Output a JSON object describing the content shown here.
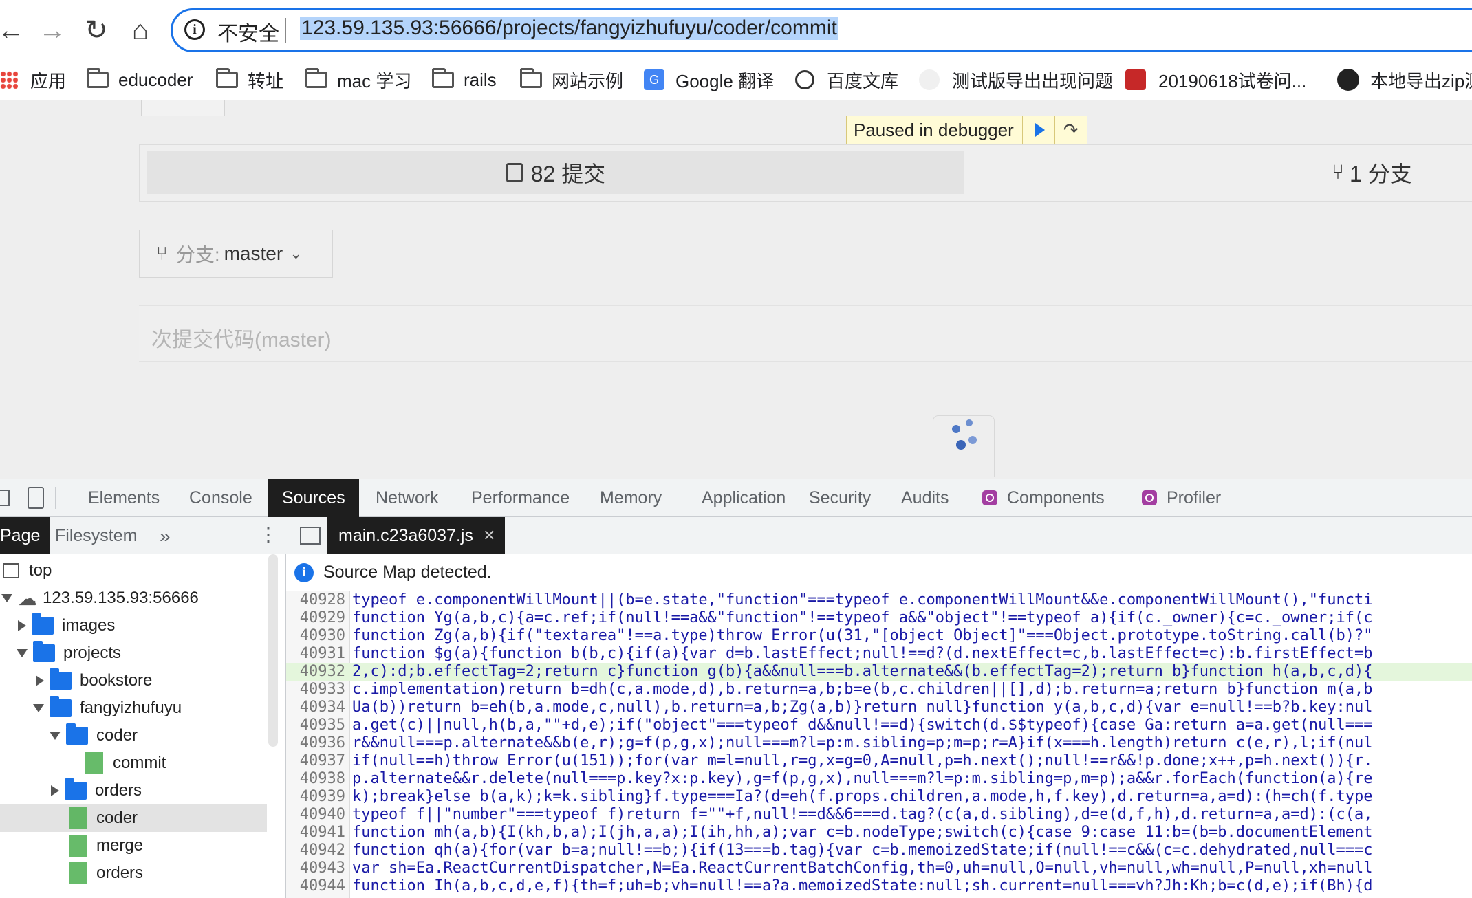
{
  "browser": {
    "security_label": "不安全",
    "url": "123.59.135.93:56666/projects/fangyizhufuyu/coder/commit",
    "bookmarks": [
      "应用",
      "educoder",
      "转址",
      "mac 学习",
      "rails",
      "网站示例",
      "Google 翻译",
      "百度文库",
      "测试版导出出现问题",
      "20190618试卷问...",
      "本地导出zip测"
    ]
  },
  "page": {
    "debugger_banner": "Paused in debugger",
    "commits_label": "82 提交",
    "branches_label": "1 分支",
    "branch_prefix": "分支:",
    "branch_value": "master",
    "commit_placeholder": "次提交代码(master)"
  },
  "devtools": {
    "tabs": [
      "Elements",
      "Console",
      "Sources",
      "Network",
      "Performance",
      "Memory",
      "Application",
      "Security",
      "Audits",
      "Components",
      "Profiler"
    ],
    "active_tab": "Sources",
    "navigator_tabs": [
      "Page",
      "Filesystem"
    ],
    "tree": [
      {
        "label": "top",
        "type": "frame"
      },
      {
        "label": "123.59.135.93:56666",
        "type": "origin"
      },
      {
        "label": "images",
        "type": "folder"
      },
      {
        "label": "projects",
        "type": "folder"
      },
      {
        "label": "bookstore",
        "type": "folder"
      },
      {
        "label": "fangyizhufuyu",
        "type": "folder"
      },
      {
        "label": "coder",
        "type": "folder"
      },
      {
        "label": "commit",
        "type": "file"
      },
      {
        "label": "orders",
        "type": "folder"
      },
      {
        "label": "coder",
        "type": "file"
      },
      {
        "label": "merge",
        "type": "file"
      },
      {
        "label": "orders",
        "type": "file"
      }
    ],
    "open_file": "main.c23a6037.js",
    "info_message": "Source Map detected.",
    "code_lines": [
      {
        "n": "40928",
        "text": "typeof e.componentWillMount||(b=e.state,\"function\"===typeof e.componentWillMount&&e.componentWillMount(),\"functi"
      },
      {
        "n": "40929",
        "text": "function Yg(a,b,c){a=c.ref;if(null!==a&&\"function\"!==typeof a&&\"object\"!==typeof a){if(c._owner){c=c._owner;if(c"
      },
      {
        "n": "40930",
        "text": "function Zg(a,b){if(\"textarea\"!==a.type)throw Error(u(31,\"[object Object]\"===Object.prototype.toString.call(b)?\""
      },
      {
        "n": "40931",
        "text": "function $g(a){function b(b,c){if(a){var d=b.lastEffect;null!==d?(d.nextEffect=c,b.lastEffect=c):b.firstEffect=b"
      },
      {
        "n": "40932",
        "text": "2,c):d;b.effectTag=2;return c}function g(b){a&&null===b.alternate&&(b.effectTag=2);return b}function h(a,b,c,d){"
      },
      {
        "n": "40933",
        "text": "c.implementation)return b=dh(c,a.mode,d),b.return=a,b;b=e(b,c.children||[],d);b.return=a;return b}function m(a,b"
      },
      {
        "n": "40934",
        "text": "Ua(b))return b=eh(b,a.mode,c,null),b.return=a,b;Zg(a,b)}return null}function y(a,b,c,d){var e=null!==b?b.key:nul"
      },
      {
        "n": "40935",
        "text": "a.get(c)||null,h(b,a,\"\"+d,e);if(\"object\"===typeof d&&null!==d){switch(d.$$typeof){case Ga:return a=a.get(null==="
      },
      {
        "n": "40936",
        "text": "r&&null===p.alternate&&b(e,r);g=f(p,g,x);null===m?l=p:m.sibling=p;m=p;r=A}if(x===h.length)return c(e,r),l;if(nul"
      },
      {
        "n": "40937",
        "text": "if(null==h)throw Error(u(151));for(var m=l=null,r=g,x=g=0,A=null,p=h.next();null!==r&&!p.done;x++,p=h.next()){r."
      },
      {
        "n": "40938",
        "text": "p.alternate&&r.delete(null===p.key?x:p.key),g=f(p,g,x),null===m?l=p:m.sibling=p,m=p);a&&r.forEach(function(a){re"
      },
      {
        "n": "40939",
        "text": "k);break}else b(a,k);k=k.sibling}f.type===Ia?(d=eh(f.props.children,a.mode,h,f.key),d.return=a,a=d):(h=ch(f.type"
      },
      {
        "n": "40940",
        "text": "typeof f||\"number\"===typeof f)return f=\"\"+f,null!==d&&6===d.tag?(c(a,d.sibling),d=e(d,f,h),d.return=a,a=d):(c(a,"
      },
      {
        "n": "40941",
        "text": "function mh(a,b){I(kh,b,a);I(jh,a,a);I(ih,hh,a);var c=b.nodeType;switch(c){case 9:case 11:b=(b=b.documentElement"
      },
      {
        "n": "40942",
        "text": "function qh(a){for(var b=a;null!==b;){if(13===b.tag){var c=b.memoizedState;if(null!==c&&(c=c.dehydrated,null===c"
      },
      {
        "n": "40943",
        "text": "var sh=Ea.ReactCurrentDispatcher,N=Ea.ReactCurrentBatchConfig,th=0,uh=null,O=null,vh=null,wh=null,P=null,xh=null"
      },
      {
        "n": "40944",
        "text": "function Ih(a,b,c,d,e,f){th=f;uh=b;vh=null!==a?a.memoizedState:null;sh.current=null===vh?Jh:Kh;b=c(d,e);if(Bh){d"
      }
    ]
  },
  "colors": {
    "accent": "#1a73e8",
    "highlight_line": "#e4f6dc",
    "debug_banner": "#fffbd6"
  }
}
